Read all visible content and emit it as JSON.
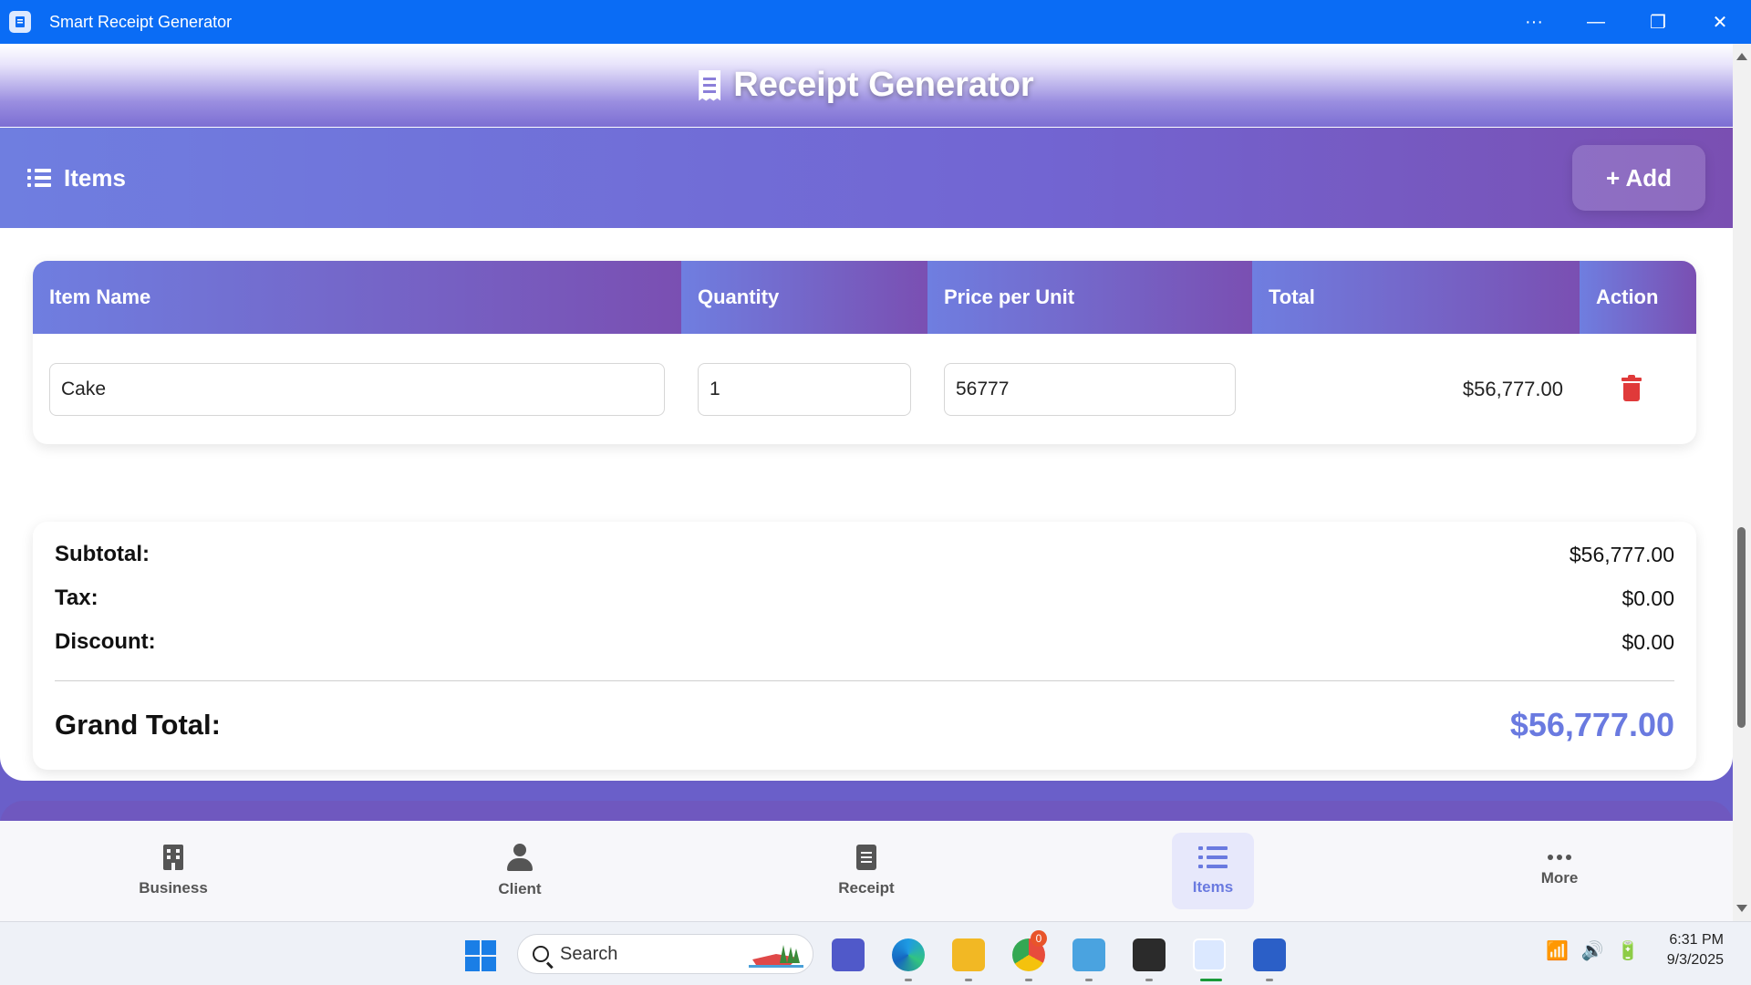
{
  "window": {
    "title": "Smart Receipt Generator",
    "controls": {
      "more": "···",
      "minimize": "—",
      "restore": "❐",
      "close": "✕"
    }
  },
  "header": {
    "title": "Receipt Generator",
    "icon": "receipt-icon"
  },
  "items_section": {
    "label": "Items",
    "icon": "list-icon",
    "add_button": "+ Add"
  },
  "table": {
    "columns": [
      "Item Name",
      "Quantity",
      "Price per Unit",
      "Total",
      "Action"
    ],
    "rows": [
      {
        "name": "Cake",
        "quantity": "1",
        "price": "56777",
        "total": "$56,777.00",
        "action_icon": "trash-icon",
        "action_color": "#e03a3a"
      }
    ]
  },
  "summary": {
    "subtotal_label": "Subtotal:",
    "subtotal": "$56,777.00",
    "tax_label": "Tax:",
    "tax": "$0.00",
    "discount_label": "Discount:",
    "discount": "$0.00",
    "grand_total_label": "Grand Total:",
    "grand_total": "$56,777.00",
    "accent_color": "#6a7ae0"
  },
  "bottom_nav": [
    {
      "label": "Business",
      "icon": "building-icon",
      "active": false
    },
    {
      "label": "Client",
      "icon": "person-icon",
      "active": false
    },
    {
      "label": "Receipt",
      "icon": "document-icon",
      "active": false
    },
    {
      "label": "Items",
      "icon": "list-icon",
      "active": true
    },
    {
      "label": "More",
      "icon": "more-dots-icon",
      "active": false
    }
  ],
  "taskbar": {
    "search_placeholder": "Search",
    "chrome_badge": "0",
    "time": "6:31 PM",
    "date": "9/3/2025"
  }
}
